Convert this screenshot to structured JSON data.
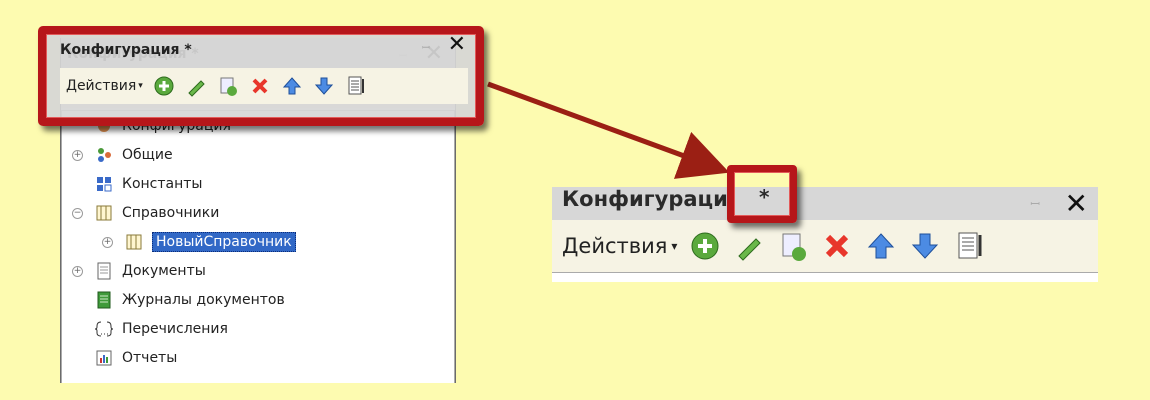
{
  "panel": {
    "title": "Конфигурация *",
    "title_short": "Конфигураци",
    "star": "*",
    "pin_glyph": "ꟷ",
    "close_glyph": "✕",
    "actions_label": "Действия",
    "caret": "▾"
  },
  "tree": {
    "items": [
      {
        "label": "Конфигурация",
        "expander": "",
        "icon": "config-icon"
      },
      {
        "label": "Общие",
        "expander": "+",
        "icon": "common-icon"
      },
      {
        "label": "Константы",
        "expander": "",
        "icon": "constants-icon"
      },
      {
        "label": "Справочники",
        "expander": "−",
        "icon": "catalog-icon"
      },
      {
        "label": "НовыйСправочник",
        "expander": "+",
        "icon": "catalog-icon",
        "selected": true
      },
      {
        "label": "Документы",
        "expander": "+",
        "icon": "document-icon"
      },
      {
        "label": "Журналы документов",
        "expander": "",
        "icon": "journal-icon"
      },
      {
        "label": "Перечисления",
        "expander": "",
        "icon": "enum-icon"
      },
      {
        "label": "Отчеты",
        "expander": "",
        "icon": "report-icon"
      }
    ]
  },
  "toolbar_icons": [
    "add-icon",
    "edit-icon",
    "copy-icon",
    "delete-icon",
    "move-up-icon",
    "move-down-icon",
    "list-icon"
  ],
  "colors": {
    "highlight_red": "#b6161a",
    "background": "#fdfbb0",
    "selection": "#3168c6"
  }
}
